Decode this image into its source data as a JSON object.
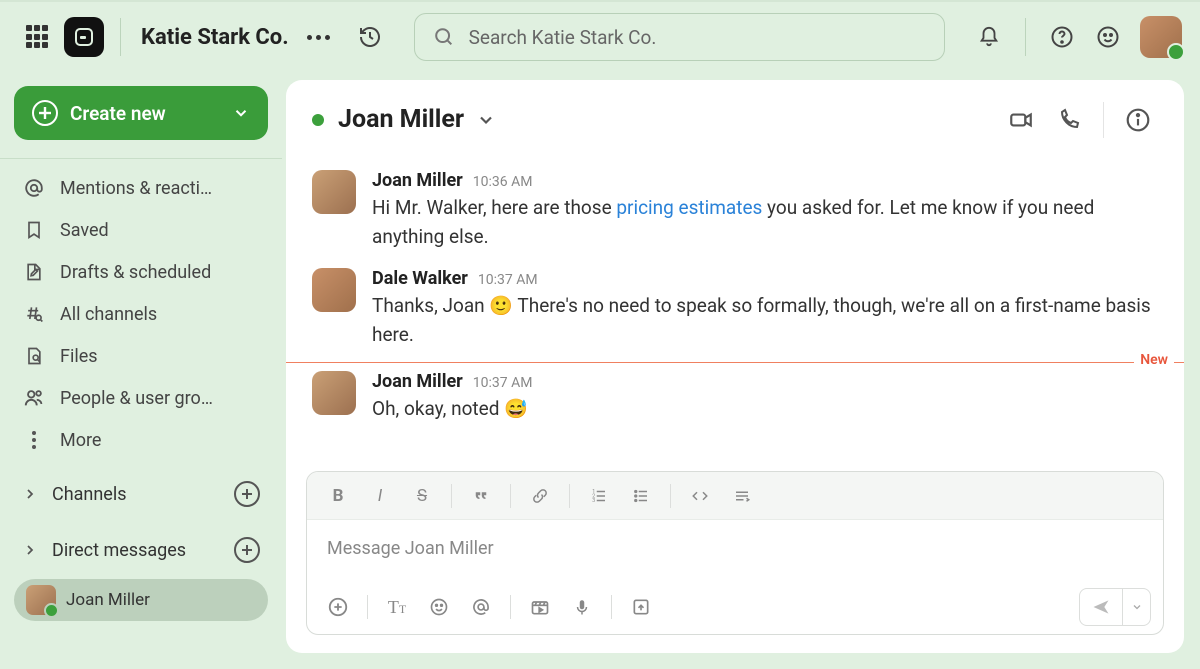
{
  "workspace": {
    "name": "Katie Stark Co."
  },
  "search": {
    "placeholder": "Search Katie Stark Co."
  },
  "sidebar": {
    "create_label": "Create new",
    "nav": [
      {
        "label": "Mentions & reacti…"
      },
      {
        "label": "Saved"
      },
      {
        "label": "Drafts & scheduled"
      },
      {
        "label": "All channels"
      },
      {
        "label": "Files"
      },
      {
        "label": "People & user gro…"
      },
      {
        "label": "More"
      }
    ],
    "sections": {
      "channels": "Channels",
      "dms": "Direct messages"
    },
    "active_dm": "Joan Miller"
  },
  "chat": {
    "title": "Joan Miller",
    "new_label": "New",
    "composer_placeholder": "Message Joan Miller",
    "messages": [
      {
        "author": "Joan Miller",
        "time": "10:36 AM",
        "text_pre": "Hi Mr. Walker, here are those ",
        "link_text": "pricing estimates",
        "text_post": " you asked for. Let me know if you need anything else."
      },
      {
        "author": "Dale Walker",
        "time": "10:37 AM",
        "text_pre": "Thanks, Joan ",
        "emoji": "🙂",
        "text_post": "  There's no need to speak so formally, though, we're all on a first-name basis here."
      },
      {
        "author": "Joan Miller",
        "time": "10:37 AM",
        "text_pre": "Oh, okay, noted ",
        "emoji": "😅"
      }
    ]
  }
}
